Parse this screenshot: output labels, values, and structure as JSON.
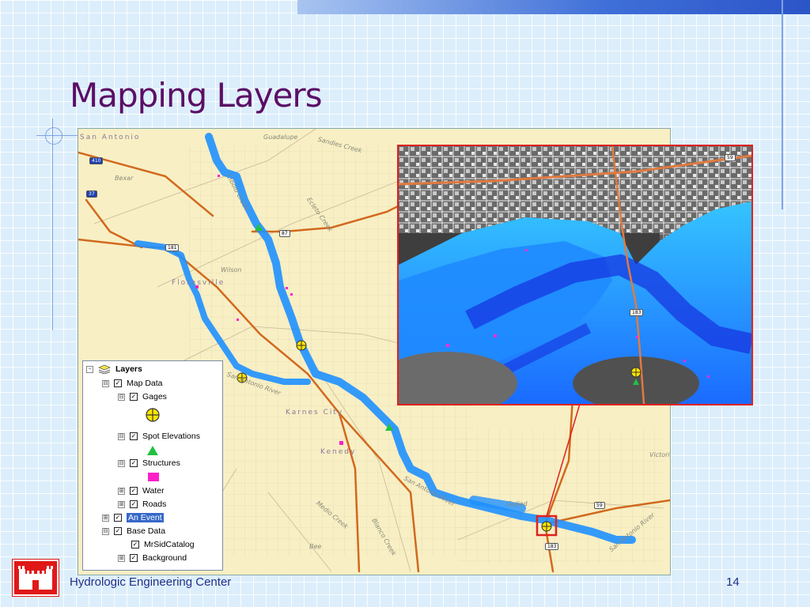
{
  "slide": {
    "title": "Mapping Layers",
    "footer": "Hydrologic Engineering Center",
    "page_number": "14"
  },
  "map": {
    "city_labels": [
      "San Antonio",
      "Floresville",
      "Karnes City",
      "Kenedy"
    ],
    "county_labels": [
      "Guadalupe",
      "Wilson",
      "Goliad",
      "Victoria",
      "Bee",
      "Bexar"
    ],
    "water_labels": [
      "Sandies Creek",
      "Cibolo Creek",
      "Ecleto Creek",
      "San Antonio River",
      "San Antonio River",
      "Medio Creek",
      "Blanco Creek",
      "San Antonio River"
    ],
    "route_shields": [
      "410",
      "37",
      "181",
      "87",
      "183",
      "59"
    ],
    "inset_shields": [
      "59",
      "183"
    ],
    "colors": {
      "water": "#1e90ff",
      "road": "#d2691e",
      "grid": "#d8cfa8",
      "background": "#f8efc4",
      "inset_border": "#e02020"
    }
  },
  "legend": {
    "title": "Layers",
    "items": [
      {
        "label": "Map Data",
        "expander": "⊟",
        "checked": true
      },
      {
        "label": "Gages",
        "expander": "⊟",
        "checked": true,
        "symbol": "gage-icon"
      },
      {
        "label": "Spot Elevations",
        "expander": "⊟",
        "checked": true,
        "symbol": "triangle-icon"
      },
      {
        "label": "Structures",
        "expander": "⊟",
        "checked": true,
        "symbol": "square-icon"
      },
      {
        "label": "Water",
        "expander": "⊞",
        "checked": true
      },
      {
        "label": "Roads",
        "expander": "⊞",
        "checked": true
      },
      {
        "label": "An Event",
        "expander": "⊞",
        "checked": true,
        "selected": true
      },
      {
        "label": "Base Data",
        "expander": "⊟",
        "checked": true
      },
      {
        "label": "MrSidCatalog",
        "expander": "",
        "checked": true
      },
      {
        "label": "Background",
        "expander": "⊞",
        "checked": true
      }
    ]
  }
}
